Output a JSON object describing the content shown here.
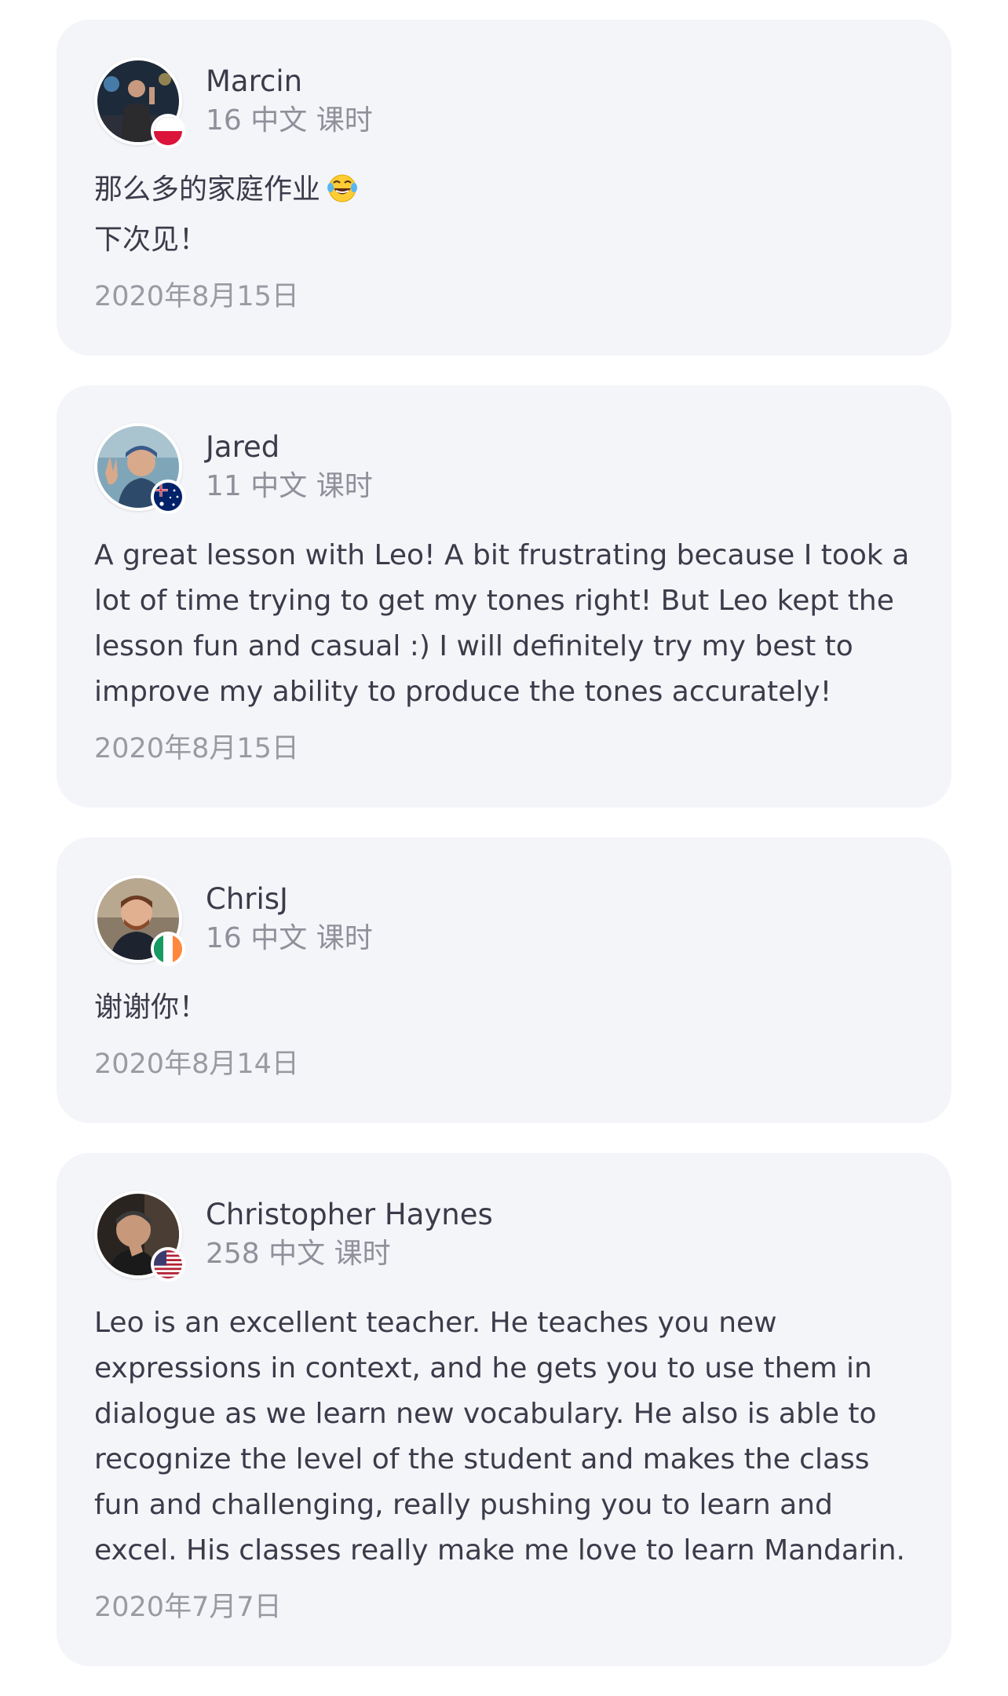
{
  "reviews": [
    {
      "name": "Marcin",
      "lessons": "16 中文 课时",
      "comment": "那么多的家庭作业",
      "comment_line2": "下次见！",
      "emoji": "laughing-tears-emoji",
      "date": "2020年8月15日",
      "flag": "poland-flag-icon"
    },
    {
      "name": "Jared",
      "lessons": "11 中文 课时",
      "comment": "A great lesson with Leo! A bit frustrating because I took a lot of time trying to get my tones right! But Leo kept the lesson fun and casual :) I will definitely try my best to improve my ability to produce the tones accurately!",
      "date": "2020年8月15日",
      "flag": "australia-flag-icon"
    },
    {
      "name": "ChrisJ",
      "lessons": "16 中文 课时",
      "comment": "谢谢你！",
      "date": "2020年8月14日",
      "flag": "ireland-flag-icon"
    },
    {
      "name": "Christopher Haynes",
      "lessons": "258 中文 课时",
      "comment": "Leo is an excellent teacher. He teaches you new expressions in context, and he gets you to use them in dialogue as we learn new vocabulary. He also is able to recognize the level of the student and makes the class fun and challenging, really pushing you to learn and excel. His classes really make me love to learn Mandarin.",
      "date": "2020年7月7日",
      "flag": "usa-flag-icon"
    }
  ],
  "colors": {
    "card_bg": "#f4f5f9",
    "name": "#3b3b4a",
    "secondary": "#8f9099"
  }
}
